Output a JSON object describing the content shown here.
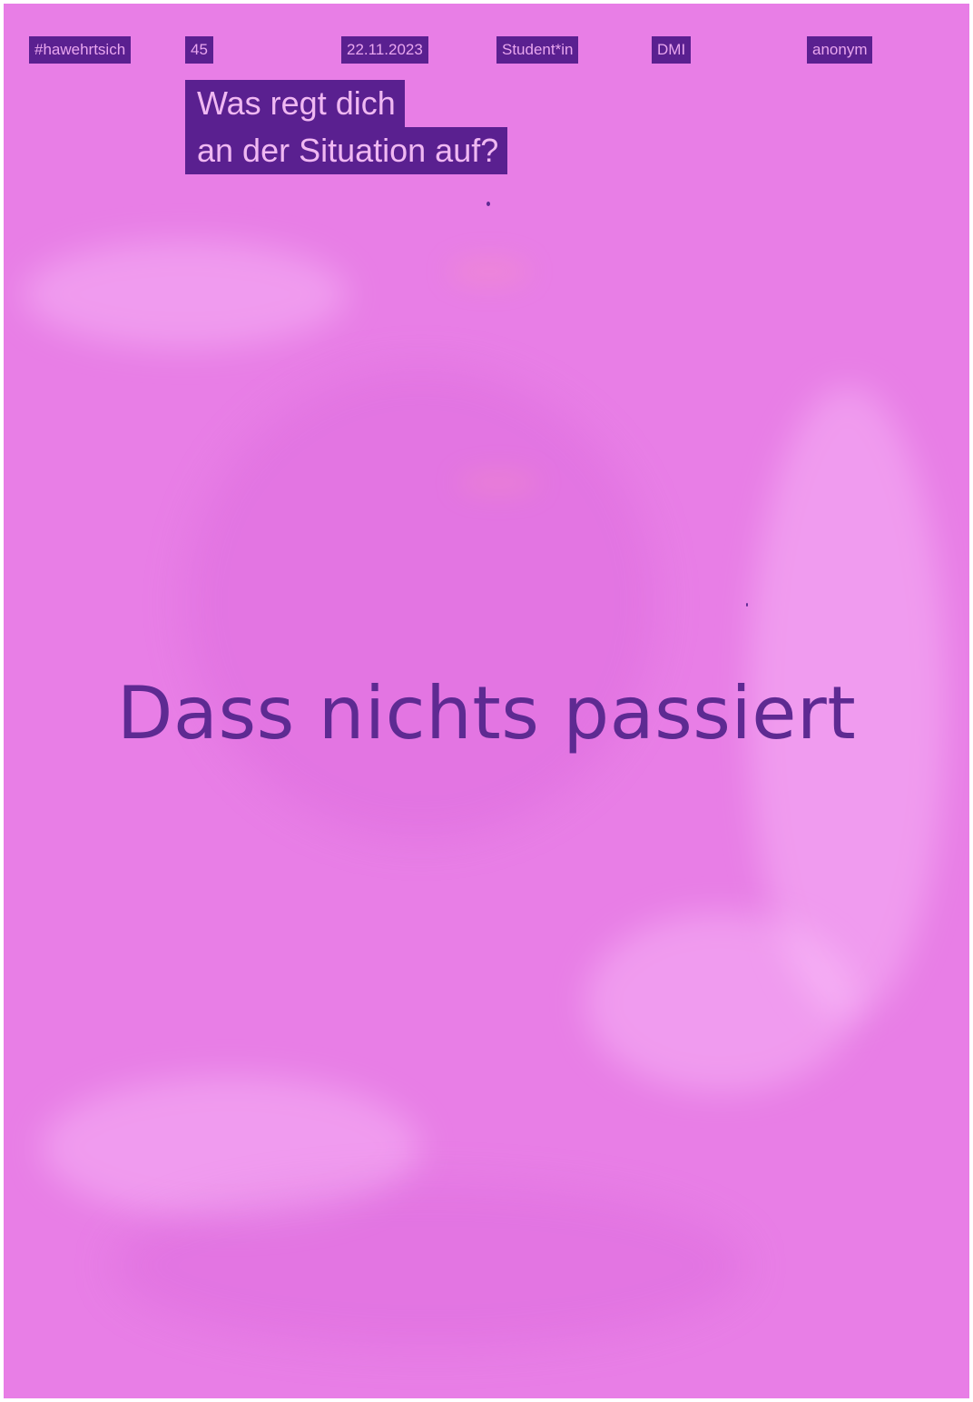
{
  "header": {
    "tags": [
      {
        "id": "hashtag",
        "text": "#hawehrtsich"
      },
      {
        "id": "number",
        "text": "45"
      },
      {
        "id": "date",
        "text": "22.11.2023"
      },
      {
        "id": "role",
        "text": "Student*in"
      },
      {
        "id": "department",
        "text": "DMI"
      },
      {
        "id": "author",
        "text": "anonym"
      }
    ]
  },
  "question": {
    "line1": "Was regt dich",
    "line2": "an der Situation auf?"
  },
  "answer": "Dass nichts passiert",
  "colors": {
    "paper": "#e87ee6",
    "ink": "#5a2090",
    "tag_text": "#e9a6ef"
  }
}
